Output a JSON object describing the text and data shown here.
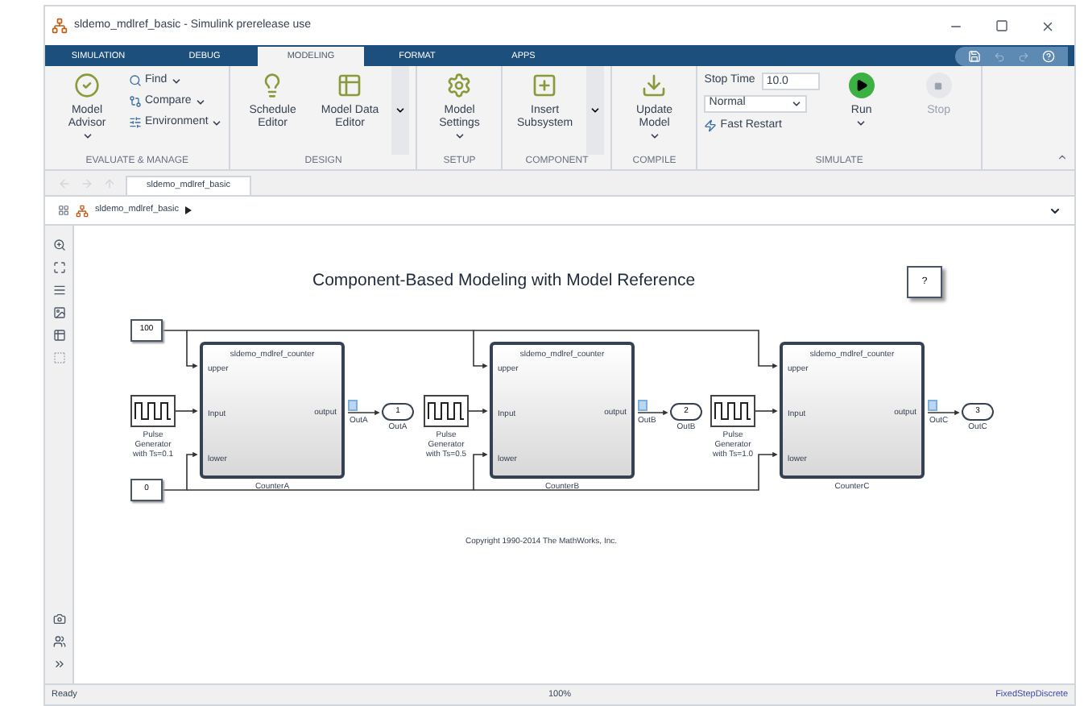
{
  "window": {
    "title": "sldemo_mdlref_basic - Simulink prerelease use"
  },
  "ribbon_tabs": [
    {
      "label": "SIMULATION",
      "selected": false
    },
    {
      "label": "DEBUG",
      "selected": false
    },
    {
      "label": "MODELING",
      "selected": true
    },
    {
      "label": "FORMAT",
      "selected": false
    },
    {
      "label": "APPS",
      "selected": false
    }
  ],
  "ribbon_groups": [
    {
      "label": "EVALUATE & MANAGE",
      "items": [
        {
          "kind": "large",
          "label": "Model Advisor",
          "menu": true,
          "disabled": false
        },
        {
          "kind": "small",
          "label": "Find",
          "menu": true
        },
        {
          "kind": "small",
          "label": "Compare",
          "menu": true
        },
        {
          "kind": "small",
          "label": "Environment",
          "menu": true
        }
      ]
    },
    {
      "label": "DESIGN",
      "items": [
        {
          "kind": "large",
          "label": "Schedule Editor",
          "menu": false,
          "disabled": false
        },
        {
          "kind": "large",
          "label": "Model Data Editor",
          "menu": false,
          "disabled": false
        },
        {
          "kind": "more"
        }
      ]
    },
    {
      "label": "SETUP",
      "items": [
        {
          "kind": "large",
          "label": "Model Settings",
          "menu": true,
          "disabled": false
        }
      ]
    },
    {
      "label": "COMPONENT",
      "items": [
        {
          "kind": "large",
          "label": "Insert Subsystem",
          "menu": false,
          "disabled": false
        },
        {
          "kind": "more"
        }
      ]
    },
    {
      "label": "COMPILE",
      "items": [
        {
          "kind": "large",
          "label": "Update Model",
          "menu": true,
          "disabled": false
        }
      ]
    },
    {
      "label": "SIMULATE",
      "items": [
        {
          "kind": "field",
          "label": "Stop Time",
          "value": "10.0"
        },
        {
          "kind": "select",
          "value": "Normal"
        },
        {
          "kind": "toggle",
          "label": "Fast Restart"
        },
        {
          "kind": "large",
          "label": "Run",
          "menu": true,
          "disabled": false
        },
        {
          "kind": "large",
          "label": "Stop",
          "menu": false,
          "disabled": true
        }
      ]
    }
  ],
  "document_tab": "sldemo_mdlref_basic",
  "breadcrumb": "sldemo_mdlref_basic",
  "canvas": {
    "title": "Component-Based Modeling with Model Reference",
    "blocks": [
      {
        "kind": "constant",
        "value": "100"
      },
      {
        "kind": "note",
        "value": "?"
      },
      {
        "kind": "pulse",
        "lines": [
          "Pulse",
          "Generator",
          "with Ts=0.1"
        ]
      },
      {
        "kind": "model",
        "title": "sldemo_mdlref_counter",
        "inputs": [
          "upper",
          "Input",
          "lower"
        ],
        "output": "output",
        "name": "CounterA"
      },
      {
        "kind": "outport",
        "value": "1",
        "signal_label": "OutA",
        "name": "OutA"
      },
      {
        "kind": "pulse",
        "lines": [
          "Pulse",
          "Generator",
          "with Ts=0.5"
        ]
      },
      {
        "kind": "model",
        "title": "sldemo_mdlref_counter",
        "inputs": [
          "upper",
          "Input",
          "lower"
        ],
        "output": "output",
        "name": "CounterB"
      },
      {
        "kind": "outport",
        "value": "2",
        "signal_label": "OutB",
        "name": "OutB"
      },
      {
        "kind": "pulse",
        "lines": [
          "Pulse",
          "Generator",
          "with Ts=1.0"
        ]
      },
      {
        "kind": "model",
        "title": "sldemo_mdlref_counter",
        "inputs": [
          "upper",
          "Input",
          "lower"
        ],
        "output": "output",
        "name": "CounterC"
      },
      {
        "kind": "outport",
        "value": "3",
        "signal_label": "OutC",
        "name": "OutC"
      },
      {
        "kind": "constant",
        "value": "0"
      }
    ],
    "copyright": "Copyright 1990-2014 The MathWorks, Inc."
  },
  "status_bar": {
    "state": "Ready",
    "zoom": "100%",
    "solver": "FixedStepDiscrete"
  }
}
